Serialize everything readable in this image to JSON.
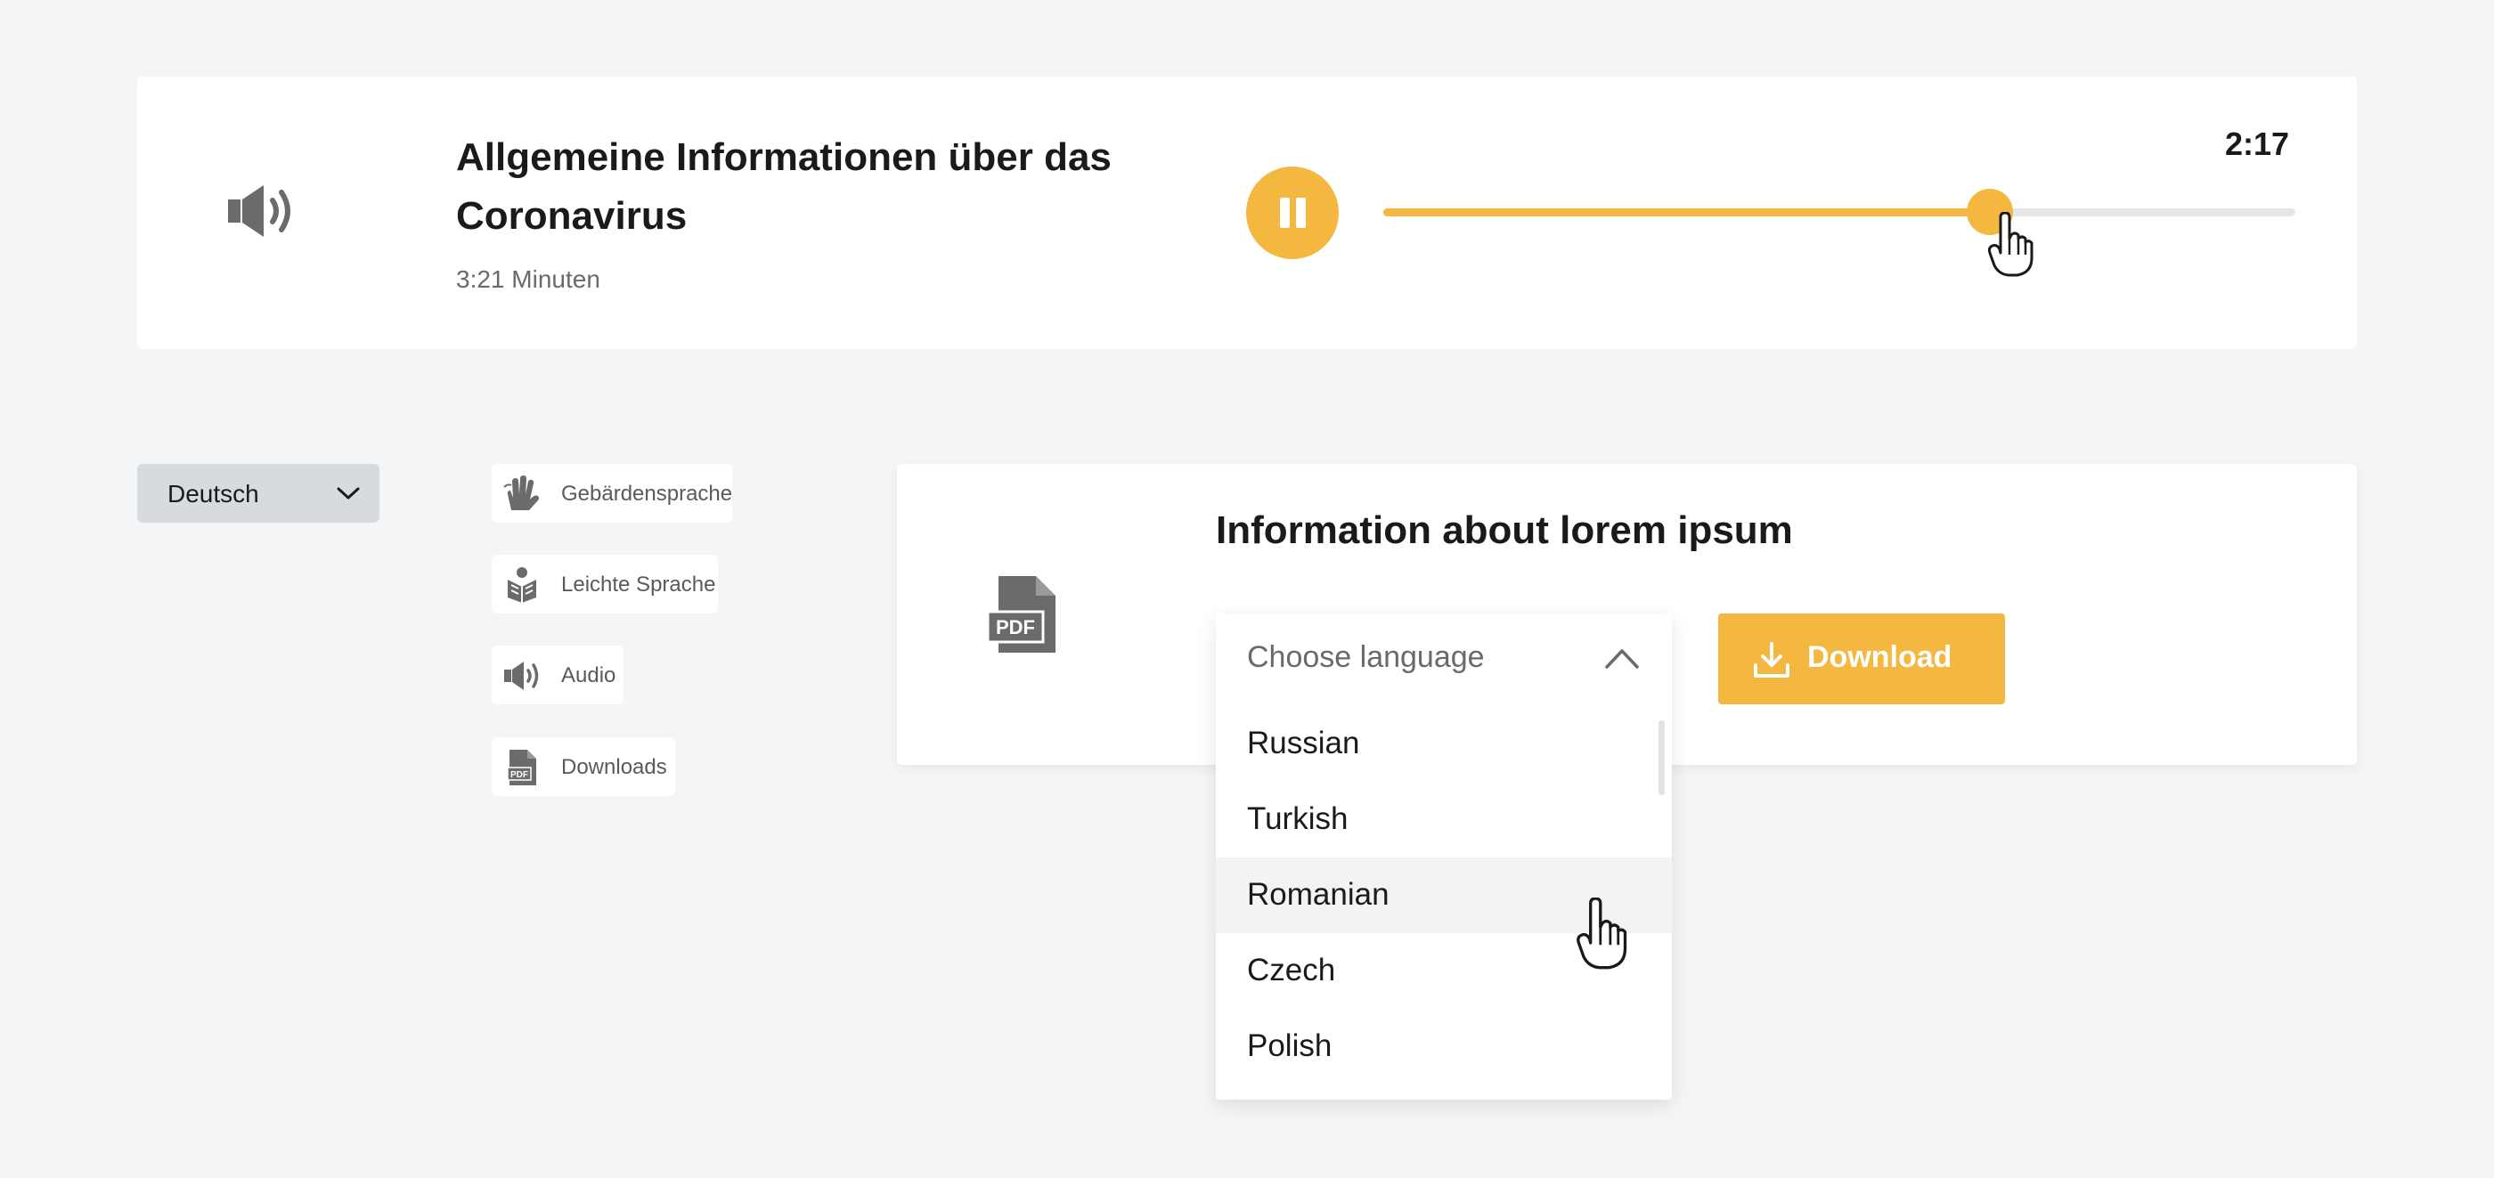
{
  "player": {
    "title": "Allgemeine Informationen über das Coronavirus",
    "duration": "3:21 Minuten",
    "time": "2:17",
    "progress": 0.665,
    "pause_label": "Pause",
    "icon": "speaker-icon"
  },
  "language_select": {
    "value": "Deutsch"
  },
  "chips": [
    {
      "label": "Gebärdensprache",
      "icon": "sign-language-icon"
    },
    {
      "label": "Leichte Sprache",
      "icon": "easy-language-icon"
    },
    {
      "label": "Audio",
      "icon": "speaker-icon"
    },
    {
      "label": "Downloads",
      "icon": "pdf-icon"
    }
  ],
  "document": {
    "title": "Information about lorem ipsum",
    "icon": "pdf-icon",
    "pdf_text": "PDF",
    "download_label": "Download"
  },
  "dropdown": {
    "placeholder": "Choose language",
    "options": [
      "Russian",
      "Turkish",
      "Romanian",
      "Czech",
      "Polish"
    ],
    "hovered": "Romanian"
  },
  "colors": {
    "accent": "#f4b740",
    "background": "#f4f5f7",
    "card": "#ffffff",
    "select": "#d7dbe0",
    "icon": "#6b6b6b"
  }
}
